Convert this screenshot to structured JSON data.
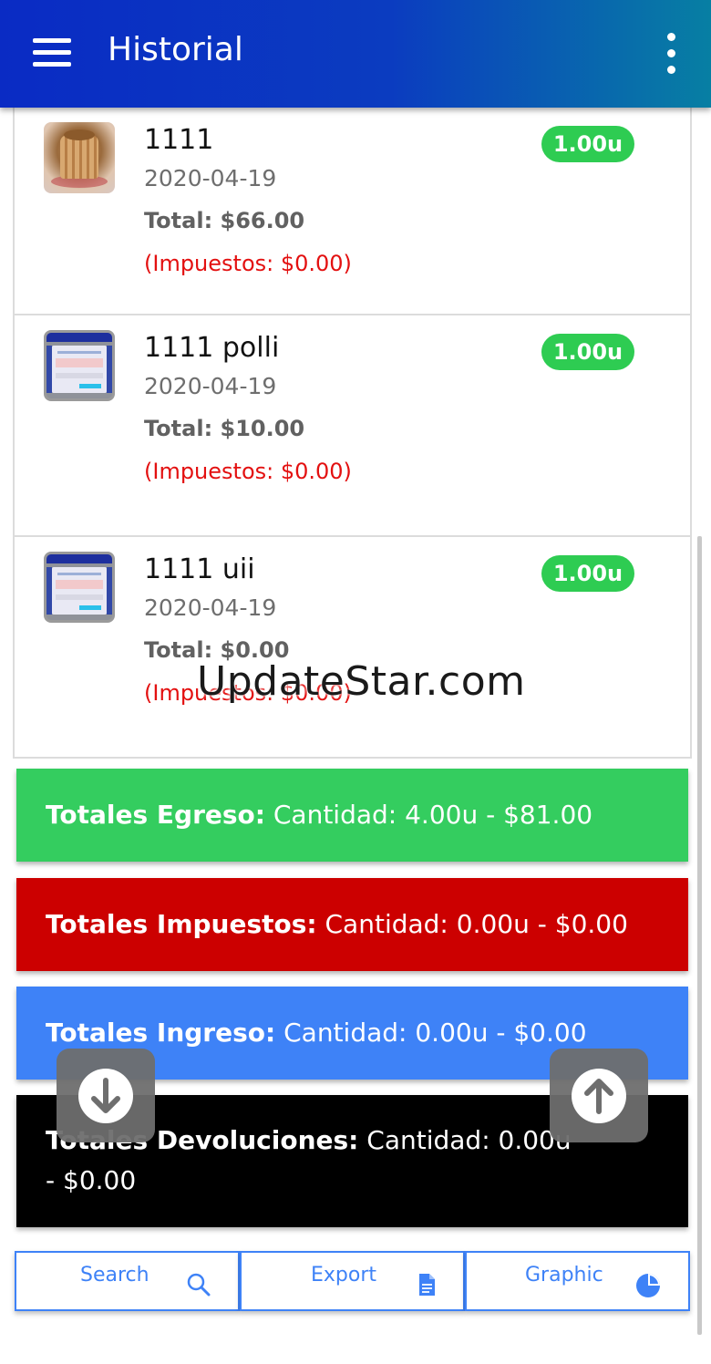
{
  "app": {
    "title": "Historial"
  },
  "icons": {
    "menu": "hamburger-menu-icon",
    "more": "more-vertical-icon",
    "scroll_down": "arrow-down-circle-icon",
    "scroll_up": "arrow-up-circle-icon",
    "search": "search-icon",
    "export": "document-icon",
    "graphic": "pie-chart-icon"
  },
  "items": [
    {
      "name": "1111",
      "date": "2020-04-19",
      "total": "Total: $66.00",
      "tax": "(Impuestos: $0.00)",
      "quantity": "1.00u",
      "thumbnail": "cake-photo"
    },
    {
      "name": "1111 polli",
      "date": "2020-04-19",
      "total": "Total: $10.00",
      "tax": "(Impuestos: $0.00)",
      "quantity": "1.00u",
      "thumbnail": "app-screenshot"
    },
    {
      "name": "1111 uii",
      "date": "2020-04-19",
      "total": "Total: $0.00",
      "tax": "(Impuestos: $0.00)",
      "quantity": "1.00u",
      "thumbnail": "app-screenshot"
    }
  ],
  "totals": {
    "egreso": {
      "label": "Totales Egreso:",
      "value": " Cantidad: 4.00u - $81.00",
      "color": "#34cd5f"
    },
    "impuestos": {
      "label": "Totales Impuestos:",
      "value": " Cantidad: 0.00u - $0.00",
      "color": "#cc0000"
    },
    "ingreso": {
      "label": "Totales Ingreso:",
      "value": " Cantidad: 0.00u - $0.00",
      "color": "#3e82f7"
    },
    "devoluciones": {
      "label": "Totales Devoluciones:",
      "value": " Cantidad: 0.00u - $0.00",
      "color": "#000000"
    }
  },
  "toolbar": {
    "search_label": "Search",
    "export_label": "Export",
    "graphic_label": "Graphic"
  },
  "watermark": "UpdateStar.com",
  "colors": {
    "appbar_start": "#0a2bc4",
    "appbar_end": "#077fa3",
    "badge": "#2ecc52",
    "tax_text": "#e31010",
    "accent": "#3e82f7"
  }
}
